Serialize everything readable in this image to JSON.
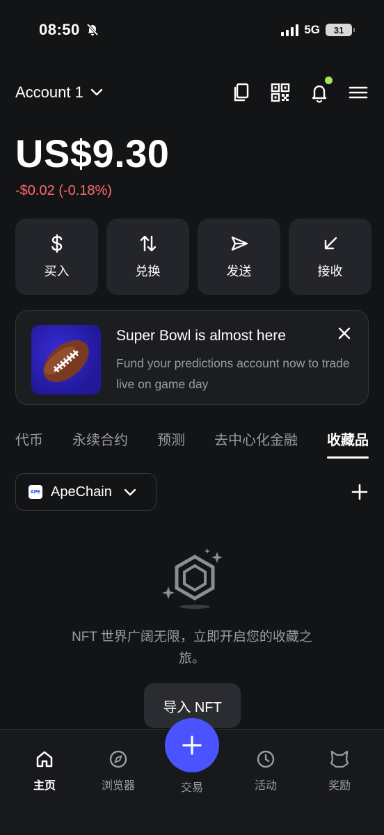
{
  "status_bar": {
    "time": "08:50",
    "network": "5G",
    "battery": "31"
  },
  "header": {
    "account_name": "Account 1"
  },
  "balance": {
    "amount": "US$9.30",
    "change": "-$0.02 (-0.18%)"
  },
  "actions": [
    {
      "label": "买入",
      "icon": "dollar-icon"
    },
    {
      "label": "兑换",
      "icon": "swap-icon"
    },
    {
      "label": "发送",
      "icon": "send-icon"
    },
    {
      "label": "接收",
      "icon": "receive-icon"
    }
  ],
  "banner": {
    "title": "Super Bowl is almost here",
    "text": "Fund your predictions account now to trade live on game day"
  },
  "tabs": [
    {
      "label": "代币",
      "active": false
    },
    {
      "label": "永续合约",
      "active": false
    },
    {
      "label": "预测",
      "active": false
    },
    {
      "label": "去中心化金融",
      "active": false
    },
    {
      "label": "收藏品",
      "active": true
    }
  ],
  "chain_selector": {
    "logo_text": "APE",
    "label": "ApeChain"
  },
  "empty_state": {
    "message": "NFT 世界广阔无限，立即开启您的收藏之旅。",
    "button_label": "导入 NFT"
  },
  "bottom_nav": [
    {
      "label": "主页",
      "icon": "home-icon",
      "active": true
    },
    {
      "label": "浏览器",
      "icon": "compass-icon",
      "active": false
    },
    {
      "label": "交易",
      "icon": "plus-icon",
      "active": false
    },
    {
      "label": "活动",
      "icon": "clock-icon",
      "active": false
    },
    {
      "label": "奖励",
      "icon": "fox-icon",
      "active": false
    }
  ],
  "colors": {
    "background": "#131416",
    "negative": "#ff6b6b",
    "accent": "#4b52ff",
    "notification_dot": "#a7e35a"
  }
}
